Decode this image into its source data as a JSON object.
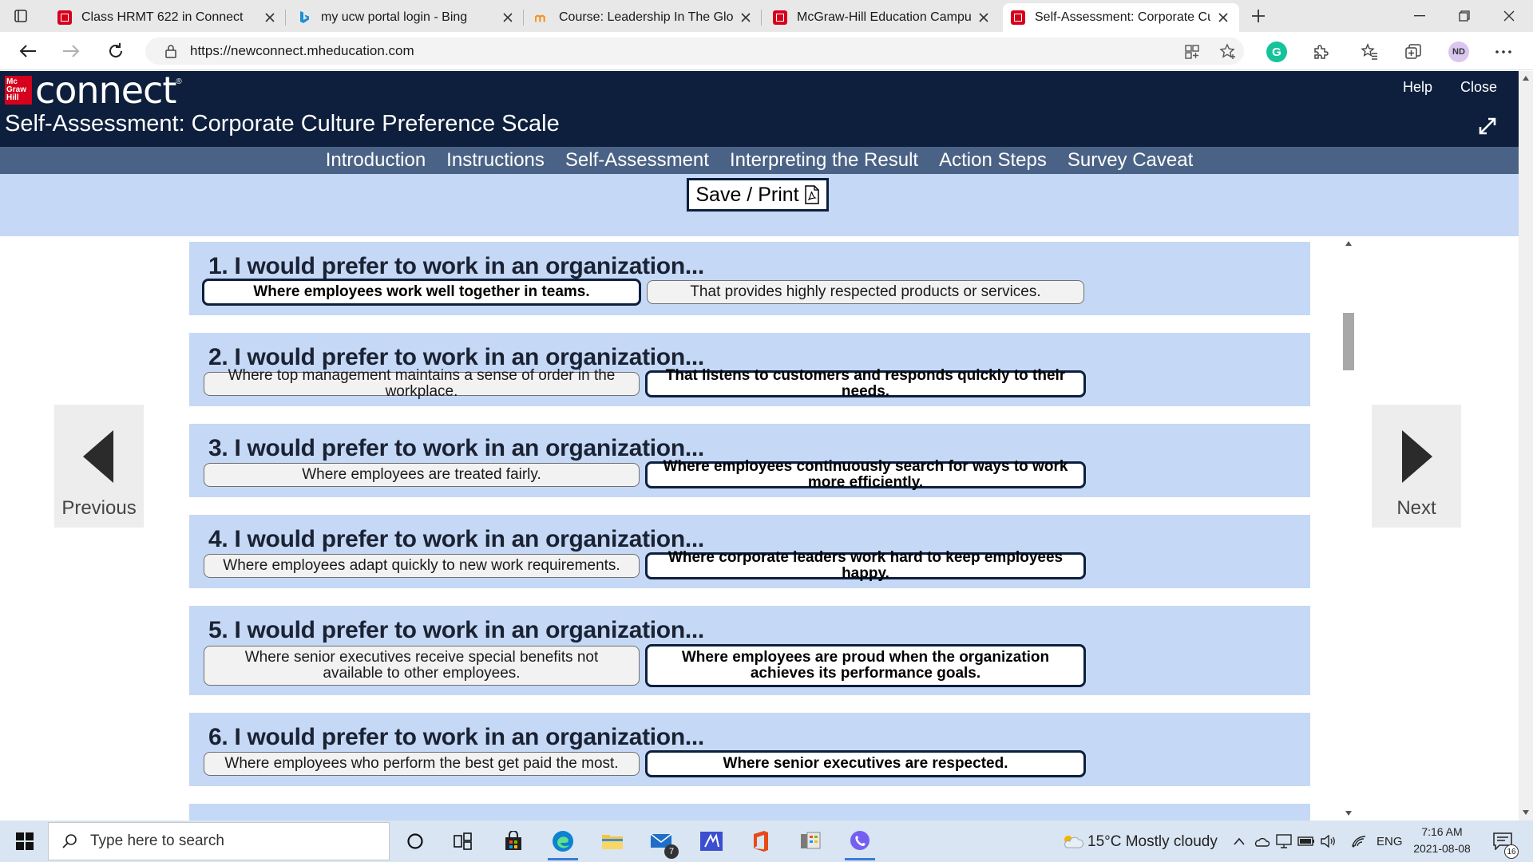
{
  "browser": {
    "tabs": [
      {
        "title": "Class HRMT 622 in Connect",
        "icon": "mcgraw-hill-icon",
        "active": false
      },
      {
        "title": "my ucw portal login - Bing",
        "icon": "bing-icon",
        "active": false
      },
      {
        "title": "Course: Leadership In The Global",
        "icon": "moodle-icon",
        "active": false
      },
      {
        "title": "McGraw-Hill Education Campus",
        "icon": "mcgraw-hill-icon",
        "active": false
      },
      {
        "title": "Self-Assessment: Corporate Cultu",
        "icon": "mcgraw-hill-icon",
        "active": true
      }
    ],
    "url": "https://newconnect.mheducation.com",
    "profile_initials": "ND"
  },
  "app": {
    "logo_badge": "Mc Graw Hill",
    "logo_text": "connect",
    "help_label": "Help",
    "close_label": "Close",
    "page_title": "Self-Assessment: Corporate Culture Preference Scale",
    "nav": [
      "Introduction",
      "Instructions",
      "Self-Assessment",
      "Interpreting the Result",
      "Action Steps",
      "Survey Caveat"
    ],
    "save_print_label": "Save / Print",
    "previous_label": "Previous",
    "next_label": "Next"
  },
  "questions": [
    {
      "title": "1. I would prefer to work in an organization...",
      "options": [
        "Where employees work well together in teams.",
        "That provides highly respected products or services."
      ],
      "selected": 0
    },
    {
      "title": "2. I would prefer to work in an organization...",
      "options": [
        "Where top management maintains a sense of order in the workplace.",
        "That listens to customers and responds quickly to their needs."
      ],
      "selected": 1
    },
    {
      "title": "3. I would prefer to work in an organization...",
      "options": [
        "Where employees are treated fairly.",
        "Where employees continuously search for ways to work more efficiently."
      ],
      "selected": 1
    },
    {
      "title": "4. I would prefer to work in an organization...",
      "options": [
        "Where employees adapt quickly to new work requirements.",
        "Where corporate leaders work hard to keep employees happy."
      ],
      "selected": 1
    },
    {
      "title": "5. I would prefer to work in an organization...",
      "options": [
        "Where senior executives receive special benefits not available to other employees.",
        "Where employees are proud when the organization achieves its performance goals."
      ],
      "selected": 1
    },
    {
      "title": "6. I would prefer to work in an organization...",
      "options": [
        "Where employees who perform the best get paid the most.",
        "Where senior executives are respected."
      ],
      "selected": 1
    }
  ],
  "taskbar": {
    "search_placeholder": "Type here to search",
    "mail_badge": "7",
    "weather": "15°C  Mostly cloudy",
    "language": "ENG",
    "time": "7:16 AM",
    "date": "2021-08-08",
    "notification_count": "16"
  },
  "colors": {
    "header_navy": "#0d1f3c",
    "nav_slate": "#4a6285",
    "question_blue": "#c5d8f5",
    "brand_red": "#d6001c"
  }
}
